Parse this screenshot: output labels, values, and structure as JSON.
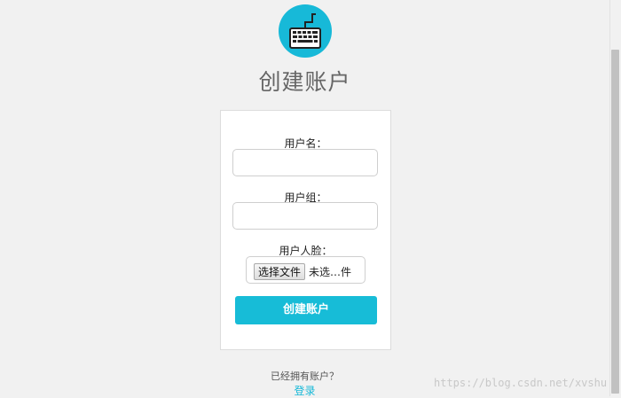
{
  "logo": {
    "icon": "keyboard-icon",
    "color": "#17b9d8"
  },
  "page_title": "创建账户",
  "form": {
    "username_label": "用户名：",
    "username_value": "",
    "group_label": "用户组：",
    "group_value": "",
    "face_label": "用户人脸：",
    "file_button_label": "选择文件",
    "file_status": "未选…件",
    "submit_label": "创建账户"
  },
  "footer": {
    "prompt": "已经拥有账户？",
    "login_link": "登录"
  },
  "watermark": "https://blog.csdn.net/xvshu",
  "colors": {
    "accent": "#17b9d8",
    "background": "#f1f1f1"
  }
}
